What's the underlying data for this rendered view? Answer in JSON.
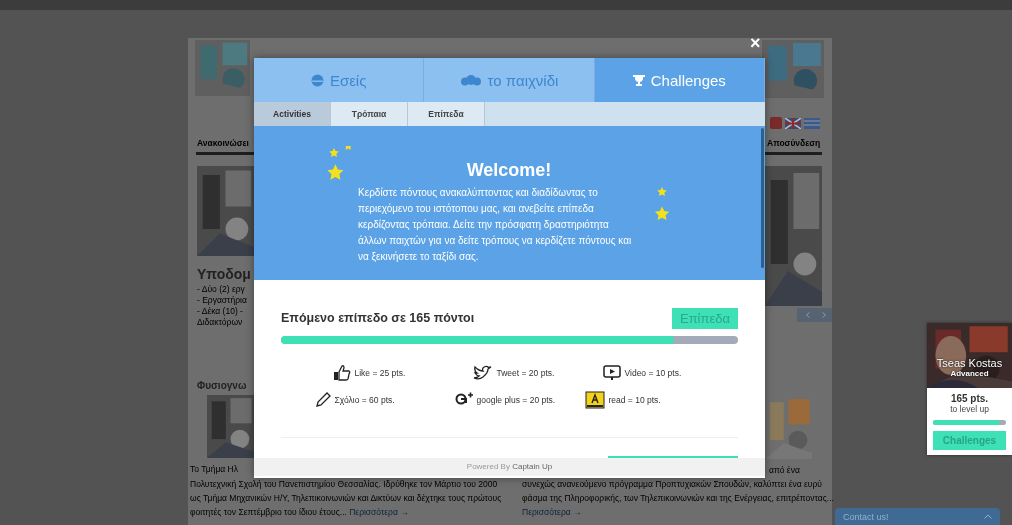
{
  "site": {
    "nav_left": "Ανακοινώσει",
    "nav_right": "Αποσύνδεση",
    "left_column": {
      "heading": "Υποδομ",
      "bullets": [
        "- Δύο (2) εργ",
        "- Εργαστήρια",
        "-  Δέκα  (10)  -",
        "Διδακτόρων"
      ],
      "section_title": "Φυσιογνω",
      "fragment": "Το Τμήμα Ηλ"
    },
    "right_column": {
      "fragment": "από ένα"
    },
    "articles": [
      {
        "text": "Πολυτεχνική Σχολή του Πανεπιστημίου Θεσσαλίας. Ιδρύθηκε τον Μάρτιο του 2000 ως Τμήμα Μηχανικών Η/Υ, Τηλεπικοινωνιών και Δικτύων και δέχτηκε τους πρώτους φοιτητές τον Σεπτέμβριο του ίδιου έτους...",
        "link": "Περισσότερα →"
      },
      {
        "text": "συνεχώς ανανεούμενο πρόγραμμα Προπτυχιακών Σπουδών, καλύπτει ένα ευρύ φάσμα της Πληροφορικής, των Τηλεπικοινωνιών και της Ενέργειας, επιτρέποντας...",
        "link": "Περισσότερα →"
      }
    ]
  },
  "modal": {
    "close": "×",
    "tabs": [
      {
        "label": "Εσείς",
        "kind": "user",
        "selected": false
      },
      {
        "label": "το παιχνίδι",
        "kind": "group",
        "selected": false
      },
      {
        "label": "Challenges",
        "kind": "trophy",
        "selected": true
      }
    ],
    "subtabs": [
      {
        "label": "Activities",
        "selected": true
      },
      {
        "label": "Τρόπαια",
        "selected": false
      },
      {
        "label": "Επίπεδα",
        "selected": false
      }
    ],
    "welcome": {
      "title": "Welcome!",
      "text": "Κερδίστε πόντους ανακαλύπτοντας και διαδίδωντας το περιεχόμενο του ιστότοπου μας, και ανεβείτε επίπεδα κερδίζοντας τρόπαια. Δείτε την πρόσφατη δραστηριότητα άλλων παιχτών για να δείτε τρόπους να κερδίζετε πόντους και να ξεκινήσετε το ταξίδι σας."
    },
    "next_level": {
      "text": "Επόμενο επίπεδο σε 165 πόντοι",
      "button": "Επίπεδα",
      "level": 0.86
    },
    "actions": [
      {
        "kind": "like",
        "text": "Like = 25 pts."
      },
      {
        "kind": "tweet",
        "text": "Tweet = 20 pts."
      },
      {
        "kind": "video",
        "text": "Video = 10 pts."
      },
      {
        "kind": "comment",
        "text": "Σχόλιο = 60 pts."
      },
      {
        "kind": "gplus",
        "text": "google plus = 20 pts."
      },
      {
        "kind": "read",
        "text": "read = 10 pts."
      }
    ],
    "footer": "Powered By **Captain Up**"
  },
  "widget": {
    "name": "Tseas Kostas",
    "rank": "Advanced",
    "points": "165 pts.",
    "caption": "to level up",
    "level": 0.9,
    "button": "Challenges"
  },
  "contact": {
    "label": "Contact us!"
  }
}
